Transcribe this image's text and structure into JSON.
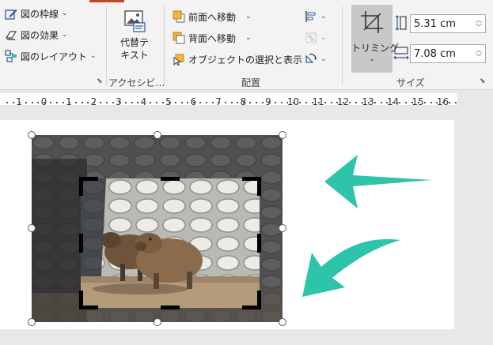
{
  "ribbon": {
    "picture_styles": {
      "border_label": "図の枠線",
      "effects_label": "図の効果",
      "layout_label": "図のレイアウト"
    },
    "accessibility": {
      "alt_text_line1": "代替テ",
      "alt_text_line2": "キスト",
      "group_label": "アクセシビ…"
    },
    "arrange": {
      "bring_forward_label": "前面へ移動",
      "send_backward_label": "背面へ移動",
      "selection_pane_label": "オブジェクトの選択と表示",
      "group_label": "配置"
    },
    "size": {
      "crop_label": "トリミング",
      "height_value": "5.31 cm",
      "width_value": "7.08 cm",
      "group_label": "サイズ"
    }
  },
  "ruler": {
    "labels": [
      "1",
      "0",
      "1",
      "2",
      "3",
      "4",
      "5",
      "6",
      "7",
      "8",
      "9",
      "10",
      "11",
      "12",
      "13",
      "14",
      "15",
      "16"
    ]
  },
  "colors": {
    "arrow": "#2ec4a9",
    "accent": "#c4452c",
    "crop_button": "#c8c8c8"
  }
}
